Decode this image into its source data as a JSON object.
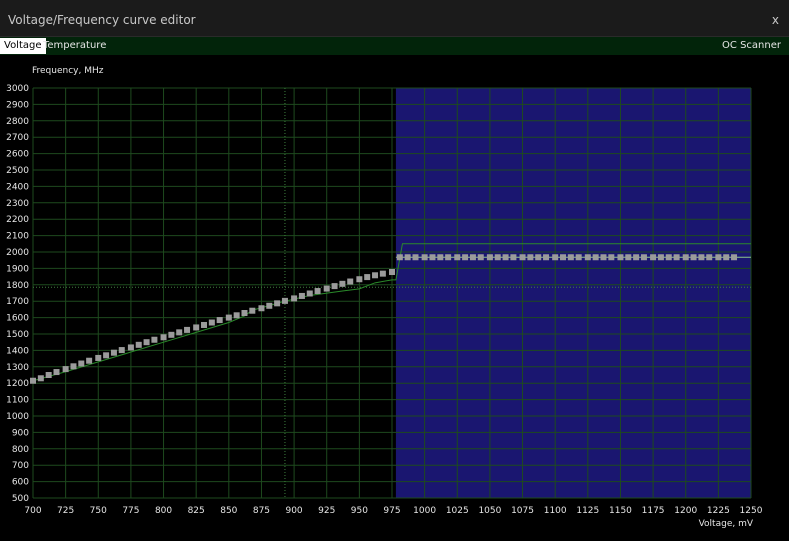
{
  "window": {
    "title": "Voltage/Frequency curve editor",
    "close_label": "x"
  },
  "tabs": [
    {
      "label": "Voltage",
      "active": true
    },
    {
      "label": "Temperature",
      "active": false
    }
  ],
  "oc_scanner_label": "OC Scanner",
  "colors": {
    "locked_region": "#1a1670",
    "grid": "#1e4a1e",
    "curve": "#8ec58e",
    "points": "#9b9b9b",
    "baseline": "#2a8a2a"
  },
  "chart_data": {
    "type": "line",
    "xlabel": "Voltage, mV",
    "ylabel": "Frequency, MHz",
    "xlim": [
      700,
      1250
    ],
    "ylim": [
      500,
      3000
    ],
    "x_ticks": [
      700,
      725,
      750,
      775,
      800,
      825,
      850,
      875,
      900,
      925,
      950,
      975,
      1000,
      1025,
      1050,
      1075,
      1100,
      1125,
      1150,
      1175,
      1200,
      1225,
      1250
    ],
    "y_ticks": [
      500,
      600,
      700,
      800,
      900,
      1000,
      1100,
      1200,
      1300,
      1400,
      1500,
      1600,
      1700,
      1800,
      1900,
      2000,
      2100,
      2200,
      2300,
      2400,
      2500,
      2600,
      2700,
      2800,
      2900,
      3000
    ],
    "cursor": {
      "voltage": 893,
      "frequency": 1785
    },
    "locked_from_voltage": 978,
    "curve_points": [
      [
        700,
        1215
      ],
      [
        706,
        1230
      ],
      [
        712,
        1250
      ],
      [
        718,
        1268
      ],
      [
        725,
        1286
      ],
      [
        731,
        1303
      ],
      [
        737,
        1320
      ],
      [
        743,
        1337
      ],
      [
        750,
        1354
      ],
      [
        756,
        1370
      ],
      [
        762,
        1386
      ],
      [
        768,
        1402
      ],
      [
        775,
        1418
      ],
      [
        781,
        1434
      ],
      [
        787,
        1450
      ],
      [
        793,
        1465
      ],
      [
        800,
        1480
      ],
      [
        806,
        1495
      ],
      [
        812,
        1510
      ],
      [
        818,
        1525
      ],
      [
        825,
        1540
      ],
      [
        831,
        1555
      ],
      [
        837,
        1570
      ],
      [
        843,
        1585
      ],
      [
        850,
        1600
      ],
      [
        856,
        1614
      ],
      [
        862,
        1628
      ],
      [
        868,
        1642
      ],
      [
        875,
        1657
      ],
      [
        881,
        1672
      ],
      [
        887,
        1687
      ],
      [
        893,
        1702
      ],
      [
        900,
        1717
      ],
      [
        906,
        1732
      ],
      [
        912,
        1747
      ],
      [
        918,
        1762
      ],
      [
        925,
        1777
      ],
      [
        931,
        1792
      ],
      [
        937,
        1806
      ],
      [
        943,
        1820
      ],
      [
        950,
        1834
      ],
      [
        956,
        1847
      ],
      [
        962,
        1858
      ],
      [
        968,
        1868
      ],
      [
        975,
        1878
      ],
      [
        981,
        1968
      ],
      [
        987,
        1968
      ],
      [
        993,
        1968
      ],
      [
        1000,
        1968
      ],
      [
        1006,
        1968
      ],
      [
        1012,
        1968
      ],
      [
        1018,
        1968
      ],
      [
        1025,
        1968
      ],
      [
        1031,
        1968
      ],
      [
        1037,
        1968
      ],
      [
        1043,
        1968
      ],
      [
        1050,
        1968
      ],
      [
        1056,
        1968
      ],
      [
        1062,
        1968
      ],
      [
        1068,
        1968
      ],
      [
        1075,
        1968
      ],
      [
        1081,
        1968
      ],
      [
        1087,
        1968
      ],
      [
        1093,
        1968
      ],
      [
        1100,
        1968
      ],
      [
        1106,
        1968
      ],
      [
        1112,
        1968
      ],
      [
        1118,
        1968
      ],
      [
        1125,
        1968
      ],
      [
        1131,
        1968
      ],
      [
        1137,
        1968
      ],
      [
        1143,
        1968
      ],
      [
        1150,
        1968
      ],
      [
        1156,
        1968
      ],
      [
        1162,
        1968
      ],
      [
        1168,
        1968
      ],
      [
        1175,
        1968
      ],
      [
        1181,
        1968
      ],
      [
        1187,
        1968
      ],
      [
        1193,
        1968
      ],
      [
        1200,
        1968
      ],
      [
        1206,
        1968
      ],
      [
        1212,
        1968
      ],
      [
        1218,
        1968
      ],
      [
        1225,
        1968
      ],
      [
        1231,
        1968
      ],
      [
        1237,
        1968
      ]
    ],
    "default_curve": [
      [
        700,
        1215
      ],
      [
        725,
        1270
      ],
      [
        750,
        1330
      ],
      [
        775,
        1390
      ],
      [
        800,
        1450
      ],
      [
        825,
        1510
      ],
      [
        850,
        1570
      ],
      [
        862,
        1610
      ],
      [
        868,
        1645
      ],
      [
        875,
        1660
      ],
      [
        893,
        1700
      ],
      [
        912,
        1735
      ],
      [
        937,
        1762
      ],
      [
        950,
        1775
      ],
      [
        962,
        1812
      ],
      [
        975,
        1830
      ],
      [
        978,
        1830
      ],
      [
        983,
        2050
      ],
      [
        1250,
        2050
      ]
    ],
    "applied_curve": [
      [
        978,
        1968
      ],
      [
        1250,
        1968
      ]
    ]
  }
}
